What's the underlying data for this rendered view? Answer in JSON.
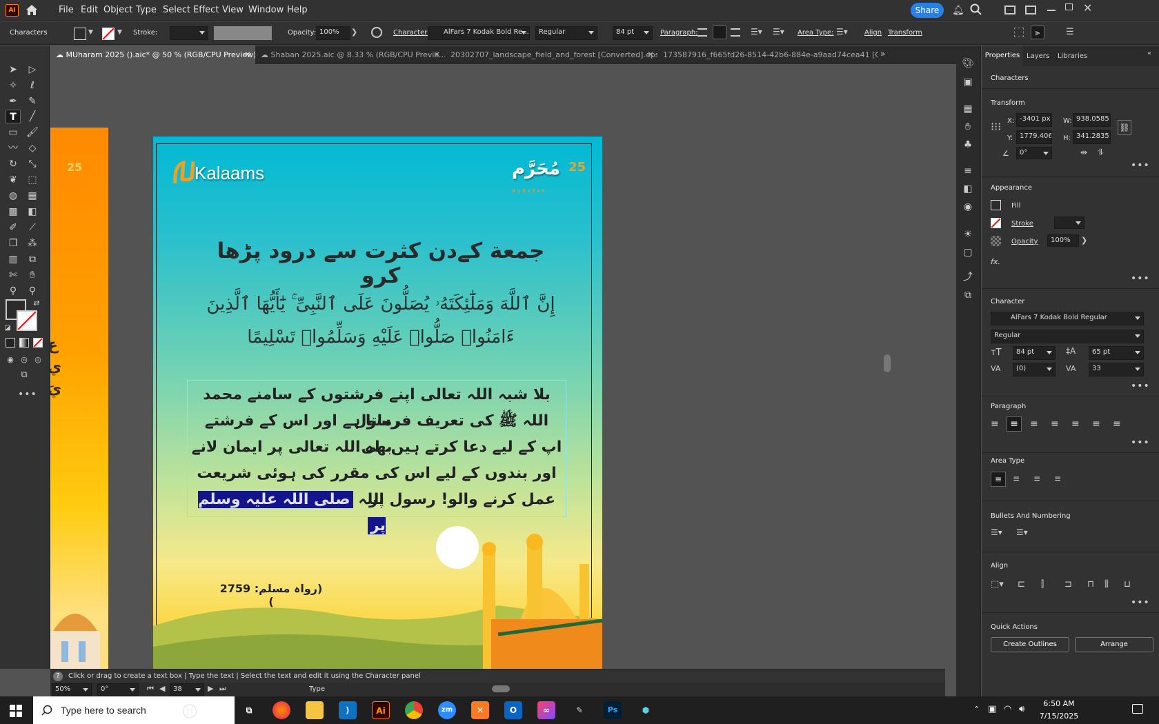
{
  "menubar": {
    "app_icon": "Ai",
    "items": [
      "File",
      "Edit",
      "Object",
      "Type",
      "Select",
      "Effect",
      "View",
      "Window",
      "Help"
    ],
    "share": "Share"
  },
  "control": {
    "characters": "Characters",
    "stroke": "Stroke:",
    "opacity": "Opacity:",
    "opacity_value": "100%",
    "character": "Character:",
    "font": "AlFars 7 Kodak Bold Re...",
    "style": "Regular",
    "size": "84 pt",
    "paragraph": "Paragraph:",
    "area_type": "Area Type:",
    "align": "Align",
    "transform": "Transform"
  },
  "tabs": [
    {
      "label": "MUharam 2025 ().aic* @ 50 % (RGB/CPU Preview)"
    },
    {
      "label": "Shaban 2025.aic @ 8.33 % (RGB/CPU Previe..."
    },
    {
      "label": "20302707_landscape_field_and_forest [Converted].eps* ..."
    },
    {
      "label": "173587916_f665fd26-8514-42b6-884e-a9aad74cea41 [Converte"
    }
  ],
  "artboard": {
    "logo_text": "Kalaams",
    "badge_number": "25",
    "badge_arabic": "مُحَرَّم",
    "badge_sub": "MUBARAK",
    "title": "جمعة کےدن کثرت سے درود پڑھا کرو",
    "verse_line1": "إِنَّ ٱللَّهَ وَمَلَٰٓئِكَتَهُۥ يُصَلُّونَ عَلَى ٱلنَّبِىِّ ۚ يَٰٓأَيُّهَا ٱلَّذِينَ",
    "verse_line2": "ءَامَنُوا۟ صَلُّوا۟ عَلَيْهِ وَسَلِّمُوا۟ تَسْلِيمًا",
    "body_line1": "بلا شبہ اللہ تعالی اپنے فرشتوں کے سامنے محمد رسول",
    "body_line2": "اللہ ﷺ کی تعریف فرماتا ہے اور اس کے فرشتے بھی",
    "body_line3": "اپ کے لیے دعا کرتے ہیں. اے اللہ تعالی پر ایمان لانے",
    "body_line4": "اور بندوں کے لیے اس کی مقرر کی ہوئی شریعت پر",
    "body_line5_plain": "عمل کرنے والو! رسول اللہ",
    "body_line5_sel": "صلی اللہ علیہ وسلم پر",
    "reference": "(رواہ مسلم: 2759 )",
    "left_badge": "25"
  },
  "status": {
    "hint": "Click or drag to create a text box  |  Type the text  |  Select the text and edit it using the Character panel",
    "zoom": "50%",
    "rotate": "0°",
    "page": "38",
    "mode": "Type"
  },
  "panel": {
    "tabs": [
      "Properties",
      "Layers",
      "Libraries"
    ],
    "characters": "Characters",
    "transform": "Transform",
    "x_label": "X:",
    "x": "-3401 px",
    "y_label": "Y:",
    "y": "1779.4067",
    "w_label": "W:",
    "w": "938.0585 p",
    "h_label": "H:",
    "h": "341.2835 p",
    "angle": "0°",
    "appearance": "Appearance",
    "fill": "Fill",
    "stroke": "Stroke",
    "opacity": "Opacity",
    "opacity_value": "100%",
    "fx": "fx.",
    "character": "Character",
    "font": "AlFars 7 Kodak Bold Regular",
    "style": "Regular",
    "size": "84 pt",
    "leading": "65 pt",
    "kerning": "(0)",
    "tracking": "33",
    "paragraph": "Paragraph",
    "area_type": "Area Type",
    "bullets": "Bullets And Numbering",
    "align": "Align",
    "quick_actions": "Quick Actions",
    "create_outlines": "Create Outlines",
    "arrange": "Arrange"
  },
  "taskbar": {
    "search_placeholder": "Type here to search",
    "time": "6:50 AM",
    "date": "7/15/2025"
  },
  "colors": {
    "accent": "#2680eb",
    "selection": "#14148c",
    "frame_orange": "#ff9800"
  }
}
